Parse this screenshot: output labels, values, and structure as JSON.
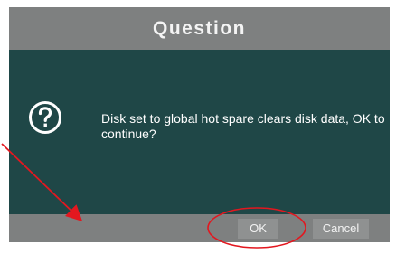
{
  "dialog": {
    "title": "Question",
    "message": "Disk set to global hot spare clears disk data, OK to continue?",
    "icon": "question-mark-icon"
  },
  "buttons": {
    "ok_label": "OK",
    "cancel_label": "Cancel"
  },
  "colors": {
    "titlebar": "#7e8080",
    "body": "#1f4747",
    "button": "#8f9191",
    "annotation": "#e3171f"
  }
}
